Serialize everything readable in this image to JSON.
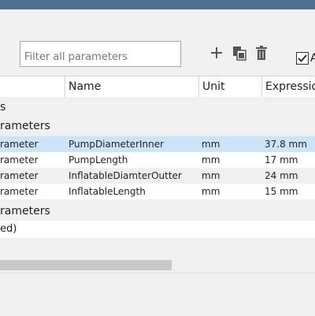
{
  "filter": {
    "placeholder": "Filter all parameters"
  },
  "toolbar": {
    "add_icon": "plus-icon",
    "copy_icon": "copy-icon",
    "delete_icon": "trash-icon",
    "checkbox_label": "A",
    "checkbox_checked": true
  },
  "columns": [
    {
      "label": ""
    },
    {
      "label": "Name"
    },
    {
      "label": "Unit"
    },
    {
      "label": "Expressio"
    }
  ],
  "groups": {
    "g1": "s",
    "g2": "rameters",
    "g3": "rameters",
    "g3_sub": "ed)"
  },
  "rows": [
    {
      "type": "rameter",
      "name": "PumpDiameterInner",
      "unit": "mm",
      "expression": "37.8 mm",
      "selected": true
    },
    {
      "type": "rameter",
      "name": "PumpLength",
      "unit": "mm",
      "expression": "17 mm",
      "selected": false
    },
    {
      "type": "rameter",
      "name": "InflatableDiamterOutter",
      "unit": "mm",
      "expression": "24 mm",
      "selected": false
    },
    {
      "type": "rameter",
      "name": "InflatableLength",
      "unit": "mm",
      "expression": "15 mm",
      "selected": false
    }
  ],
  "colors": {
    "selection": "#cde3f7",
    "title_bar": "#4f6f8f"
  }
}
